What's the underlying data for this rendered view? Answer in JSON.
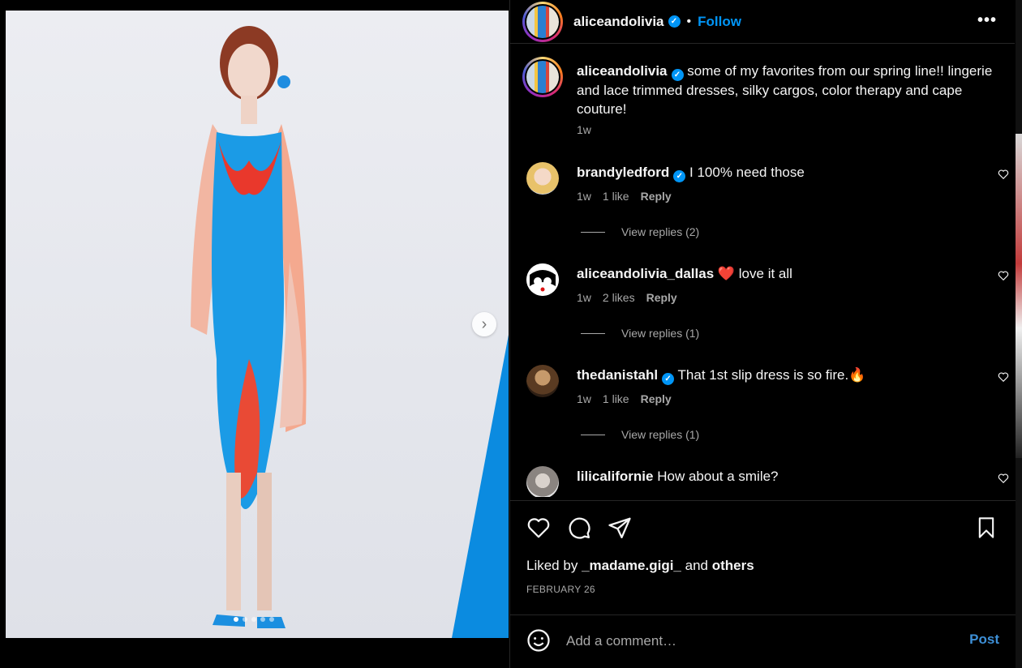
{
  "post": {
    "username": "aliceandolivia",
    "follow_label": "Follow",
    "more_label": "•••",
    "separator": "•",
    "caption_text": "some of my favorites from our spring line!! lingerie and lace trimmed dresses, silky cargos, color therapy and cape couture!",
    "caption_time": "1w",
    "media_next_label": "›",
    "media_dots": 5,
    "media_active_dot": 0
  },
  "comments": [
    {
      "username": "brandyledford",
      "verified": true,
      "text": "I 100% need those",
      "time": "1w",
      "likes": "1 like",
      "reply_label": "Reply",
      "view_replies": "View replies (2)"
    },
    {
      "username": "aliceandolivia_dallas",
      "verified": false,
      "text": "❤️ love it all",
      "time": "1w",
      "likes": "2 likes",
      "reply_label": "Reply",
      "view_replies": "View replies (1)"
    },
    {
      "username": "thedanistahl",
      "verified": true,
      "text": "That 1st slip dress is so fire.🔥",
      "time": "1w",
      "likes": "1 like",
      "reply_label": "Reply",
      "view_replies": "View replies (1)"
    },
    {
      "username": "lilicalifornie",
      "verified": false,
      "text": "How about a smile?",
      "time": "",
      "likes": "",
      "reply_label": "",
      "view_replies": ""
    }
  ],
  "footer": {
    "liked_by_prefix": "Liked by",
    "liked_by_user": "_madame.gigi_",
    "liked_by_and": "and",
    "liked_by_others": "others",
    "date": "FEBRUARY 26",
    "comment_placeholder": "Add a comment…",
    "post_label": "Post"
  },
  "colors": {
    "accent": "#0095f6",
    "background": "#000000",
    "muted_text": "#a8a8a8"
  },
  "icons": [
    "heart-icon",
    "comment-icon",
    "share-icon",
    "bookmark-icon",
    "emoji-icon",
    "verified-icon",
    "chevron-right-icon"
  ]
}
